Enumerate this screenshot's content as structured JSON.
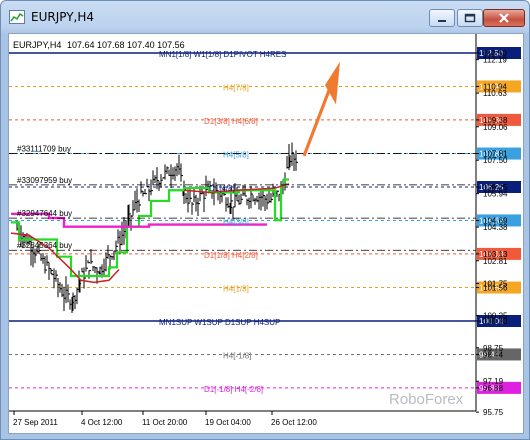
{
  "window": {
    "title": "EURJPY,H4"
  },
  "header": {
    "symbol_tf": "EURJPY,H4",
    "ohlc": "107.64 107.68 107.40 107.56"
  },
  "price_scale": {
    "ticks": [
      "112.50",
      "112.19",
      "110.94",
      "110.63",
      "109.38",
      "109.06",
      "107.81",
      "107.50",
      "106.25",
      "105.94",
      "104.69",
      "104.38",
      "103.13",
      "102.81",
      "101.75",
      "101.56",
      "100.25",
      "100.00",
      "98.75",
      "98.44",
      "97.19",
      "96.88",
      "95.75"
    ],
    "current_price": "107.56"
  },
  "time_axis": {
    "labels": [
      "27 Sep 2011",
      "4 Oct 12:00",
      "11 Oct 20:00",
      "19 Oct 04:00",
      "26 Oct 12:00"
    ]
  },
  "levels": [
    {
      "name": "mn1-8-line",
      "label": "MN1[1/8] W1[1/8] D1PIVOT H4RES",
      "price": 112.5,
      "price_label": "112.50",
      "color": "#0a1f7a",
      "box": "#0a1f7a"
    },
    {
      "name": "h4-7-8-line",
      "label": "H4[7/8]",
      "price": 110.94,
      "price_label": "110.94",
      "color": "#e8a020",
      "box": "#f5a623"
    },
    {
      "name": "d1-3-8-line",
      "label": "D1[3/8] H4[6/8]",
      "price": 109.38,
      "price_label": "109.38",
      "color": "#f05a3a",
      "box": "#f05a3a"
    },
    {
      "name": "h4-5-8-line",
      "label": "H4[5/8]",
      "price": 107.81,
      "price_label": "107.81",
      "color": "#3aa0e0",
      "box": "#3aa0e0"
    },
    {
      "name": "d1-4-8-line",
      "label": "D1[4/8]",
      "price": 106.25,
      "price_label": "106.25",
      "color": "#0a1f7a",
      "box": "#0a1f7a"
    },
    {
      "name": "h4-3-8-line",
      "label": "H4[3/8]",
      "price": 104.69,
      "price_label": "104.69",
      "color": "#3aa0e0",
      "box": "#3aa0e0"
    },
    {
      "name": "d1-2-8-line",
      "label": "D1[1/8] H4[2/8]",
      "price": 103.13,
      "price_label": "103.13",
      "color": "#f05a3a",
      "box": "#f05a3a"
    },
    {
      "name": "h4-1-8-line",
      "label": "H4[1/8]",
      "price": 101.56,
      "price_label": "101.56",
      "color": "#e8a020",
      "box": "#f5a623"
    },
    {
      "name": "mn1sup-line",
      "label": "MN1SUP W1SUP D1SUP H4SUP",
      "price": 100.0,
      "price_label": "100.00",
      "color": "#0a1f7a",
      "box": "#0a1f7a"
    },
    {
      "name": "h4-m1-8-line",
      "label": "H4[-1/8]",
      "price": 98.44,
      "price_label": "98.44",
      "color": "#777777",
      "box": "#666666"
    },
    {
      "name": "d1-m1-8-line",
      "label": "D1[-1/8] H4[-2/8]",
      "price": 96.88,
      "price_label": "96.88",
      "color": "#e020e0",
      "box": "#e020e0"
    }
  ],
  "orders": [
    {
      "label": "#33111709 buy"
    },
    {
      "label": "#33097959 buy"
    },
    {
      "label": "#32947644 buy"
    },
    {
      "label": "#32845364 buy"
    }
  ],
  "watermark": "RoboForex",
  "colors": {
    "green_line": "#22dd22",
    "magenta_line": "#ee22cc",
    "red_line": "#cc2222",
    "arrow": "#f07a30",
    "candles": "#000000"
  }
}
